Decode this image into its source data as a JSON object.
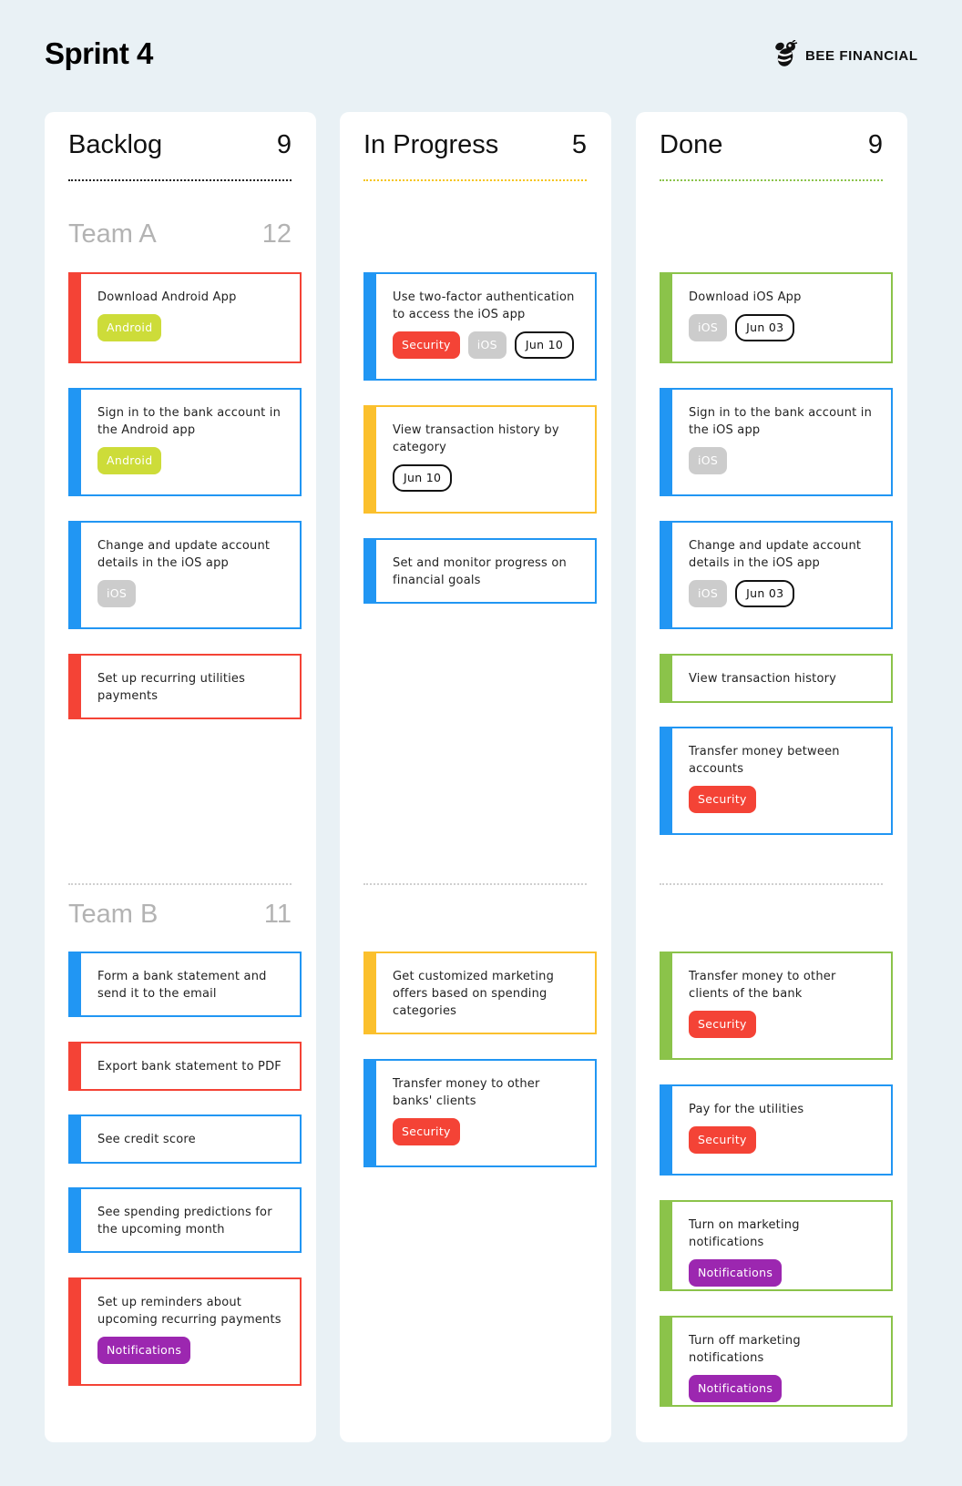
{
  "header": {
    "title": "Sprint 4",
    "brand": "BEE FINANCIAL",
    "brand_icon": "bee-icon"
  },
  "colors": {
    "background": "#e9f1f5",
    "red": "#f44336",
    "blue": "#2196f3",
    "yellow": "#fbc02d",
    "green": "#8bc34a",
    "tag_android": "#cddc39",
    "tag_ios": "#cccccc",
    "tag_security": "#f44336",
    "tag_notifications": "#9c27b0"
  },
  "teams": [
    {
      "name": "Team A",
      "count": "12"
    },
    {
      "name": "Team B",
      "count": "11"
    }
  ],
  "columns": [
    {
      "title": "Backlog",
      "count": "9",
      "team_a": [
        {
          "title": "Download Android App",
          "color": "red",
          "tags": [
            {
              "label": "Android",
              "kind": "android"
            }
          ]
        },
        {
          "title": "Sign in to the bank account in the Android app",
          "color": "blue",
          "tags": [
            {
              "label": "Android",
              "kind": "android"
            }
          ]
        },
        {
          "title": "Change and update account details in the iOS app",
          "color": "blue",
          "tags": [
            {
              "label": "iOS",
              "kind": "ios"
            }
          ]
        },
        {
          "title": "Set up recurring utilities payments",
          "color": "red",
          "tags": []
        }
      ],
      "team_b": [
        {
          "title": "Form a bank statement and send it to the email",
          "color": "blue",
          "tags": []
        },
        {
          "title": "Export bank statement to PDF",
          "color": "red",
          "tags": []
        },
        {
          "title": "See credit score",
          "color": "blue",
          "tags": []
        },
        {
          "title": "See spending predictions for the upcoming month",
          "color": "blue",
          "tags": []
        },
        {
          "title": "Set up reminders about upcoming recurring payments",
          "color": "red",
          "tags": [
            {
              "label": "Notifications",
              "kind": "notifications"
            }
          ]
        }
      ]
    },
    {
      "title": "In Progress",
      "count": "5",
      "team_a": [
        {
          "title": "Use two-factor authentication to access the iOS app",
          "color": "blue",
          "tags": [
            {
              "label": "Security",
              "kind": "security"
            },
            {
              "label": "iOS",
              "kind": "ios"
            },
            {
              "label": "Jun 10",
              "kind": "date"
            }
          ]
        },
        {
          "title": "View transaction history by category",
          "color": "yellow",
          "tags": [
            {
              "label": "Jun 10",
              "kind": "date"
            }
          ]
        },
        {
          "title": "Set and monitor progress on financial goals",
          "color": "blue",
          "tags": []
        }
      ],
      "team_b": [
        {
          "title": "Get customized marketing offers based on spending categories",
          "color": "yellow",
          "tags": []
        },
        {
          "title": "Transfer money to other banks' clients",
          "color": "blue",
          "tags": [
            {
              "label": "Security",
              "kind": "security"
            }
          ]
        }
      ]
    },
    {
      "title": "Done",
      "count": "9",
      "team_a": [
        {
          "title": "Download iOS App",
          "color": "green",
          "tags": [
            {
              "label": "iOS",
              "kind": "ios"
            },
            {
              "label": "Jun 03",
              "kind": "date"
            }
          ]
        },
        {
          "title": "Sign in to the bank account in the iOS app",
          "color": "blue",
          "tags": [
            {
              "label": "iOS",
              "kind": "ios"
            }
          ]
        },
        {
          "title": "Change and update account details in the iOS app",
          "color": "blue",
          "tags": [
            {
              "label": "iOS",
              "kind": "ios"
            },
            {
              "label": "Jun 03",
              "kind": "date"
            }
          ]
        },
        {
          "title": "View transaction history",
          "color": "green",
          "tags": []
        },
        {
          "title": "Transfer money between accounts",
          "color": "blue",
          "tags": [
            {
              "label": "Security",
              "kind": "security"
            }
          ]
        }
      ],
      "team_b": [
        {
          "title": "Transfer money to other clients of the bank",
          "color": "green",
          "tags": [
            {
              "label": "Security",
              "kind": "security"
            }
          ]
        },
        {
          "title": "Pay for the utilities",
          "color": "blue",
          "tags": [
            {
              "label": "Security",
              "kind": "security"
            }
          ]
        },
        {
          "title": "Turn on marketing notifications",
          "color": "green",
          "tags": [
            {
              "label": "Notifications",
              "kind": "notifications"
            }
          ]
        },
        {
          "title": "Turn off marketing notifications",
          "color": "green",
          "tags": [
            {
              "label": "Notifications",
              "kind": "notifications"
            }
          ]
        }
      ]
    }
  ]
}
